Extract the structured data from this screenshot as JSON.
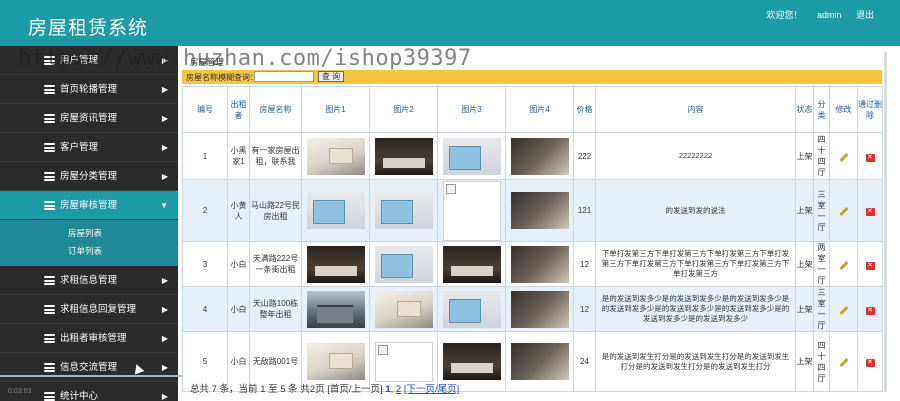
{
  "header": {
    "title": "房屋租赁系统",
    "welcome": "欢迎您！",
    "user": "admin",
    "logout": "退出"
  },
  "watermark": "https://www.huzhan.com/ishop39397",
  "sidebar": {
    "items": [
      {
        "label": "用户管理"
      },
      {
        "label": "首页轮播管理"
      },
      {
        "label": "房屋资讯管理"
      },
      {
        "label": "客户管理"
      },
      {
        "label": "房屋分类管理"
      },
      {
        "label": "房屋审核管理"
      },
      {
        "label": "求租信息管理"
      },
      {
        "label": "求租信息回复管理"
      },
      {
        "label": "出租者审核管理"
      },
      {
        "label": "信息交流管理"
      },
      {
        "label": "统计中心"
      }
    ],
    "submenu": [
      "房屋列表",
      "订单列表"
    ],
    "time": "0:03:03"
  },
  "content": {
    "crumb": "房屋管理",
    "search_label": "房屋名称模糊查询：",
    "search_value": "",
    "search_button": "查 询",
    "columns": [
      "编号",
      "出租者",
      "房屋名称",
      "图片1",
      "图片2",
      "图片3",
      "图片4",
      "价格",
      "内容",
      "状态",
      "分类",
      "修改",
      "通过删除"
    ],
    "rows": [
      {
        "id": "1",
        "renter": "小黑家1",
        "name": "有一家房屋出租，联系我",
        "price": "222",
        "content": "22222222",
        "status": "上架",
        "category": "四十四厅"
      },
      {
        "id": "2",
        "renter": "小黄人",
        "name": "马山路22号民房出租",
        "price": "121",
        "content": "的发送到发的说法",
        "status": "上架",
        "category": "三室一厅"
      },
      {
        "id": "3",
        "renter": "小白",
        "name": "天满路222号一条街出租",
        "price": "12",
        "content": "下单打发第三方下单打发第三方下单打发第三方下单打发第三方下单打发第三方下单打发第三方下单打发第三方下单打发第三方",
        "status": "上架",
        "category": "两室一厅"
      },
      {
        "id": "4",
        "renter": "小白",
        "name": "天山路100栋整年出租",
        "price": "12",
        "content": "是的发送到发多少是的发送到发多少是的发送到发多少是的发送到发多少是的发送到发多少是的发送到发多少是的发送到发多少是的发送到发多少",
        "status": "上架",
        "category": "三室一厅"
      },
      {
        "id": "5",
        "renter": "小白",
        "name": "无敌路001号",
        "price": "24",
        "content": "是的发送到发生打分是的发送到发生打分是的发送到发生打分是的发送到发生打分是的发送到发生打分",
        "status": "上架",
        "category": "四十四厅"
      }
    ]
  },
  "pager": {
    "summary": "总共 7 条，当前 1 至 5 条 共2页",
    "first_prev": "[首页/上一页]",
    "page1": "1",
    "page2": "2",
    "next_last": "[下一页/尾页]"
  }
}
